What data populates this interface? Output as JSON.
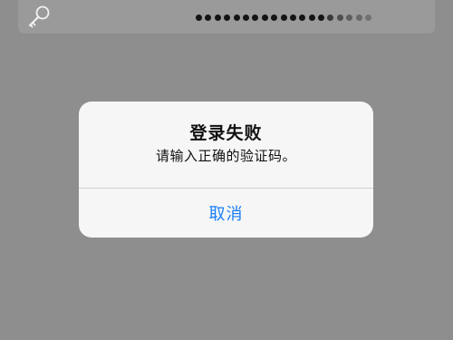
{
  "background_field": {
    "icon": "key-icon",
    "password_dot_count": 19,
    "password_dot_color": "#141414"
  },
  "alert": {
    "title": "登录失败",
    "message": "请输入正确的验证码。",
    "button_label": "取消",
    "button_color": "#1a7ef7"
  }
}
